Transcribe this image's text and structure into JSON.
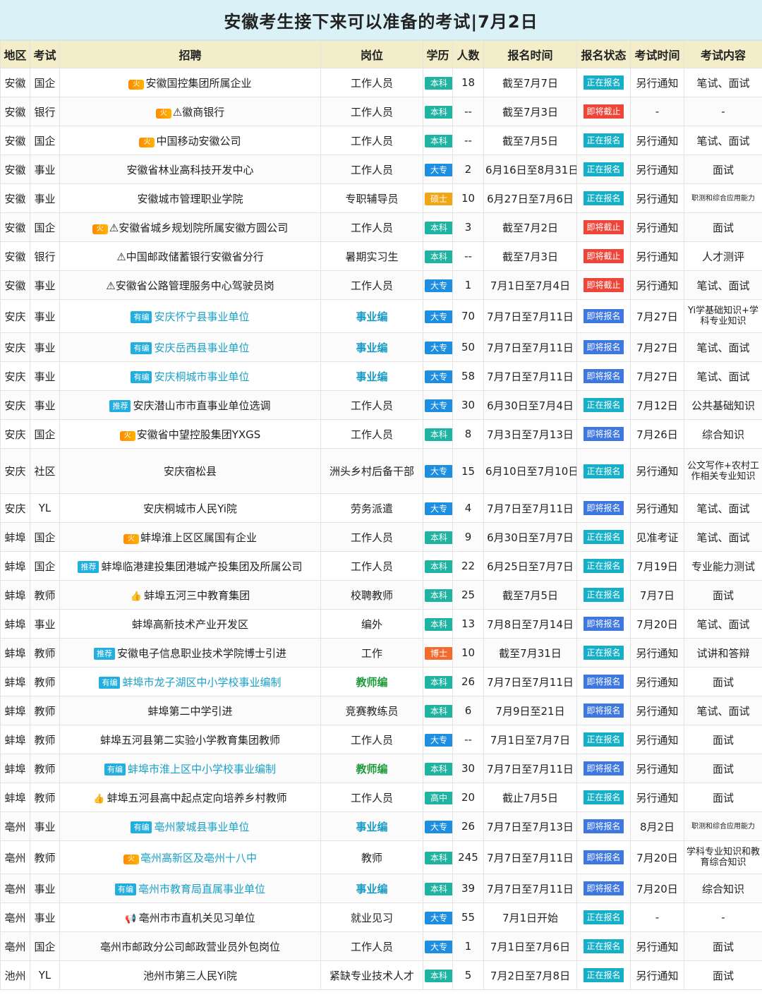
{
  "title": "安徽考生接下来可以准备的考试|7月2日",
  "headers": [
    "地区",
    "考试",
    "招聘",
    "岗位",
    "学历",
    "人数",
    "报名时间",
    "报名状态",
    "考试时间",
    "考试内容"
  ],
  "colors": {
    "header_bg": "#f4edc9",
    "title_bg": "#d9f1f7",
    "edu_benke": "#1fb3a2",
    "edu_dazhuan": "#1e8fe0",
    "edu_shuoshi": "#f3a516",
    "edu_boshi": "#f26a2e",
    "edu_gaozhong": "#1fb3a2",
    "status_open": "#15b0c8",
    "status_closing": "#ee4538",
    "status_soon": "#3e77e0"
  },
  "rows": [
    {
      "region": "安徽",
      "type": "国企",
      "tag": "fire",
      "tag_label": "火",
      "recruit": "安徽国控集团所属企业",
      "rstyle": "",
      "post": "工作人员",
      "pstyle": "",
      "edu": "本科",
      "count": "18",
      "time": "截至7月7日",
      "status": "正在报名",
      "exam": "另行通知",
      "content": "笔试、面试",
      "cstyle": ""
    },
    {
      "region": "安徽",
      "type": "银行",
      "tag": "fire",
      "tag_label": "火",
      "recruit": "⚠徽商银行",
      "rstyle": "",
      "post": "工作人员",
      "pstyle": "",
      "edu": "本科",
      "count": "--",
      "time": "截至7月3日",
      "status": "即将截止",
      "exam": "-",
      "content": "-",
      "cstyle": ""
    },
    {
      "region": "安徽",
      "type": "国企",
      "tag": "fire",
      "tag_label": "火",
      "recruit": "中国移动安徽公司",
      "rstyle": "",
      "post": "工作人员",
      "pstyle": "",
      "edu": "本科",
      "count": "--",
      "time": "截至7月5日",
      "status": "正在报名",
      "exam": "另行通知",
      "content": "笔试、面试",
      "cstyle": ""
    },
    {
      "region": "安徽",
      "type": "事业",
      "tag": "",
      "tag_label": "",
      "recruit": "安徽省林业高科技开发中心",
      "rstyle": "",
      "post": "工作人员",
      "pstyle": "",
      "edu": "大专",
      "count": "2",
      "time": "6月16日至8月31日",
      "status": "正在报名",
      "exam": "另行通知",
      "content": "面试",
      "cstyle": ""
    },
    {
      "region": "安徽",
      "type": "事业",
      "tag": "",
      "tag_label": "",
      "recruit": "安徽城市管理职业学院",
      "rstyle": "",
      "post": "专职辅导员",
      "pstyle": "",
      "edu": "硕士",
      "count": "10",
      "time": "6月27日至7月6日",
      "status": "正在报名",
      "exam": "另行通知",
      "content": "职测和综合应用能力",
      "cstyle": "small"
    },
    {
      "region": "安徽",
      "type": "国企",
      "tag": "fire",
      "tag_label": "火",
      "recruit": "⚠安徽省城乡规划院所属安徽方圆公司",
      "rstyle": "",
      "post": "工作人员",
      "pstyle": "",
      "edu": "本科",
      "count": "3",
      "time": "截至7月2日",
      "status": "即将截止",
      "exam": "另行通知",
      "content": "面试",
      "cstyle": ""
    },
    {
      "region": "安徽",
      "type": "银行",
      "tag": "",
      "tag_label": "",
      "recruit": "⚠中国邮政储蓄银行安徽省分行",
      "rstyle": "",
      "post": "暑期实习生",
      "pstyle": "",
      "edu": "本科",
      "count": "--",
      "time": "截至7月3日",
      "status": "即将截止",
      "exam": "另行通知",
      "content": "人才测评",
      "cstyle": ""
    },
    {
      "region": "安徽",
      "type": "事业",
      "tag": "",
      "tag_label": "",
      "recruit": "⚠安徽省公路管理服务中心驾驶员岗",
      "rstyle": "",
      "post": "工作人员",
      "pstyle": "",
      "edu": "大专",
      "count": "1",
      "time": "7月1日至7月4日",
      "status": "即将截止",
      "exam": "另行通知",
      "content": "笔试、面试",
      "cstyle": ""
    },
    {
      "region": "安庆",
      "type": "事业",
      "tag": "you",
      "tag_label": "有编",
      "recruit": "安庆怀宁县事业单位",
      "rstyle": "teal",
      "post": "事业编",
      "pstyle": "teal-bold",
      "edu": "大专",
      "count": "70",
      "time": "7月7日至7月11日",
      "status": "即将报名",
      "exam": "7月27日",
      "content": "Yi学基础知识+学科专业知识",
      "cstyle": "wrap",
      "tall": "tall"
    },
    {
      "region": "安庆",
      "type": "事业",
      "tag": "you",
      "tag_label": "有编",
      "recruit": "安庆岳西县事业单位",
      "rstyle": "teal",
      "post": "事业编",
      "pstyle": "teal-bold",
      "edu": "大专",
      "count": "50",
      "time": "7月7日至7月11日",
      "status": "即将报名",
      "exam": "7月27日",
      "content": "笔试、面试",
      "cstyle": ""
    },
    {
      "region": "安庆",
      "type": "事业",
      "tag": "you",
      "tag_label": "有编",
      "recruit": "安庆桐城市事业单位",
      "rstyle": "teal",
      "post": "事业编",
      "pstyle": "teal-bold",
      "edu": "大专",
      "count": "58",
      "time": "7月7日至7月11日",
      "status": "即将报名",
      "exam": "7月27日",
      "content": "笔试、面试",
      "cstyle": ""
    },
    {
      "region": "安庆",
      "type": "事业",
      "tag": "tui",
      "tag_label": "推荐",
      "recruit": "安庆潜山市市直事业单位选调",
      "rstyle": "",
      "post": "工作人员",
      "pstyle": "",
      "edu": "大专",
      "count": "30",
      "time": "6月30日至7月4日",
      "status": "正在报名",
      "exam": "7月12日",
      "content": "公共基础知识",
      "cstyle": ""
    },
    {
      "region": "安庆",
      "type": "国企",
      "tag": "fire",
      "tag_label": "火",
      "recruit": "安徽省中望控股集团YXGS",
      "rstyle": "",
      "post": "工作人员",
      "pstyle": "",
      "edu": "本科",
      "count": "8",
      "time": "7月3日至7月13日",
      "status": "即将报名",
      "exam": "7月26日",
      "content": "综合知识",
      "cstyle": ""
    },
    {
      "region": "安庆",
      "type": "社区",
      "tag": "",
      "tag_label": "",
      "recruit": "安庆宿松县",
      "rstyle": "",
      "post": "洲头乡村后备干部",
      "pstyle": "",
      "edu": "大专",
      "count": "15",
      "time": "6月10日至7月10日",
      "status": "正在报名",
      "exam": "另行通知",
      "content": "公文写作+农村工作相关专业知识",
      "cstyle": "wrap",
      "tall": "xtall"
    },
    {
      "region": "安庆",
      "type": "YL",
      "tag": "",
      "tag_label": "",
      "recruit": "安庆桐城市人民Yi院",
      "rstyle": "",
      "post": "劳务派遣",
      "pstyle": "",
      "edu": "大专",
      "count": "4",
      "time": "7月7日至7月11日",
      "status": "即将报名",
      "exam": "另行通知",
      "content": "笔试、面试",
      "cstyle": ""
    },
    {
      "region": "蚌埠",
      "type": "国企",
      "tag": "fire",
      "tag_label": "火",
      "recruit": "蚌埠淮上区区属国有企业",
      "rstyle": "",
      "post": "工作人员",
      "pstyle": "",
      "edu": "本科",
      "count": "9",
      "time": "6月30日至7月7日",
      "status": "正在报名",
      "exam": "见准考证",
      "content": "笔试、面试",
      "cstyle": ""
    },
    {
      "region": "蚌埠",
      "type": "国企",
      "tag": "tui",
      "tag_label": "推荐",
      "recruit": "蚌埠临港建投集团港城产投集团及所属公司",
      "rstyle": "",
      "post": "工作人员",
      "pstyle": "",
      "edu": "本科",
      "count": "22",
      "time": "6月25日至7月7日",
      "status": "正在报名",
      "exam": "7月19日",
      "content": "专业能力测试",
      "cstyle": ""
    },
    {
      "region": "蚌埠",
      "type": "教师",
      "tag": "thumb",
      "tag_label": "👍",
      "recruit": "蚌埠五河三中教育集团",
      "rstyle": "",
      "post": "校聘教师",
      "pstyle": "",
      "edu": "本科",
      "count": "25",
      "time": "截至7月5日",
      "status": "正在报名",
      "exam": "7月7日",
      "content": "面试",
      "cstyle": ""
    },
    {
      "region": "蚌埠",
      "type": "事业",
      "tag": "",
      "tag_label": "",
      "recruit": "蚌埠高新技术产业开发区",
      "rstyle": "",
      "post": "编外",
      "pstyle": "",
      "edu": "本科",
      "count": "13",
      "time": "7月8日至7月14日",
      "status": "即将报名",
      "exam": "7月20日",
      "content": "笔试、面试",
      "cstyle": ""
    },
    {
      "region": "蚌埠",
      "type": "教师",
      "tag": "tui",
      "tag_label": "推荐",
      "recruit": "安徽电子信息职业技术学院博士引进",
      "rstyle": "",
      "post": "工作",
      "pstyle": "",
      "edu": "博士",
      "count": "10",
      "time": "截至7月31日",
      "status": "正在报名",
      "exam": "另行通知",
      "content": "试讲和答辩",
      "cstyle": ""
    },
    {
      "region": "蚌埠",
      "type": "教师",
      "tag": "you",
      "tag_label": "有编",
      "recruit": "蚌埠市龙子湖区中小学校事业编制",
      "rstyle": "teal",
      "post": "教师编",
      "pstyle": "green-bold",
      "edu": "本科",
      "count": "26",
      "time": "7月7日至7月11日",
      "status": "即将报名",
      "exam": "另行通知",
      "content": "面试",
      "cstyle": ""
    },
    {
      "region": "蚌埠",
      "type": "教师",
      "tag": "",
      "tag_label": "",
      "recruit": "蚌埠第二中学引进",
      "rstyle": "",
      "post": "竞赛教练员",
      "pstyle": "",
      "edu": "本科",
      "count": "6",
      "time": "7月9日至21日",
      "status": "即将报名",
      "exam": "另行通知",
      "content": "笔试、面试",
      "cstyle": ""
    },
    {
      "region": "蚌埠",
      "type": "教师",
      "tag": "",
      "tag_label": "",
      "recruit": "蚌埠五河县第二实验小学教育集团教师",
      "rstyle": "",
      "post": "工作人员",
      "pstyle": "",
      "edu": "大专",
      "count": "--",
      "time": "7月1日至7月7日",
      "status": "正在报名",
      "exam": "另行通知",
      "content": "面试",
      "cstyle": ""
    },
    {
      "region": "蚌埠",
      "type": "教师",
      "tag": "you",
      "tag_label": "有编",
      "recruit": "蚌埠市淮上区中小学校事业编制",
      "rstyle": "teal",
      "post": "教师编",
      "pstyle": "green-bold",
      "edu": "本科",
      "count": "30",
      "time": "7月7日至7月11日",
      "status": "即将报名",
      "exam": "另行通知",
      "content": "面试",
      "cstyle": ""
    },
    {
      "region": "蚌埠",
      "type": "教师",
      "tag": "thumb",
      "tag_label": "👍",
      "recruit": "蚌埠五河县高中起点定向培养乡村教师",
      "rstyle": "",
      "post": "工作人员",
      "pstyle": "",
      "edu": "高中",
      "count": "20",
      "time": "截止7月5日",
      "status": "正在报名",
      "exam": "另行通知",
      "content": "面试",
      "cstyle": ""
    },
    {
      "region": "亳州",
      "type": "事业",
      "tag": "you",
      "tag_label": "有编",
      "recruit": "亳州蒙城县事业单位",
      "rstyle": "teal",
      "post": "事业编",
      "pstyle": "teal-bold",
      "edu": "大专",
      "count": "26",
      "time": "7月7日至7月13日",
      "status": "即将报名",
      "exam": "8月2日",
      "content": "职测和综合应用能力",
      "cstyle": "small"
    },
    {
      "region": "亳州",
      "type": "教师",
      "tag": "fire",
      "tag_label": "火",
      "recruit": "亳州高新区及亳州十八中",
      "rstyle": "teal",
      "post": "教师",
      "pstyle": "",
      "edu": "本科",
      "count": "245",
      "time": "7月7日至7月11日",
      "status": "即将报名",
      "exam": "7月20日",
      "content": "学科专业知识和教育综合知识",
      "cstyle": "wrap",
      "tall": "tall"
    },
    {
      "region": "亳州",
      "type": "事业",
      "tag": "you",
      "tag_label": "有编",
      "recruit": "亳州市教育局直属事业单位",
      "rstyle": "teal",
      "post": "事业编",
      "pstyle": "teal-bold",
      "edu": "本科",
      "count": "39",
      "time": "7月7日至7月11日",
      "status": "即将报名",
      "exam": "7月20日",
      "content": "综合知识",
      "cstyle": ""
    },
    {
      "region": "亳州",
      "type": "事业",
      "tag": "speaker",
      "tag_label": "📢",
      "recruit": "亳州市市直机关见习单位",
      "rstyle": "",
      "post": "就业见习",
      "pstyle": "",
      "edu": "大专",
      "count": "55",
      "time": "7月1日开始",
      "status": "正在报名",
      "exam": "-",
      "content": "-",
      "cstyle": ""
    },
    {
      "region": "亳州",
      "type": "国企",
      "tag": "",
      "tag_label": "",
      "recruit": "亳州市邮政分公司邮政营业员外包岗位",
      "rstyle": "",
      "post": "工作人员",
      "pstyle": "",
      "edu": "大专",
      "count": "1",
      "time": "7月1日至7月6日",
      "status": "正在报名",
      "exam": "另行通知",
      "content": "面试",
      "cstyle": ""
    },
    {
      "region": "池州",
      "type": "YL",
      "tag": "",
      "tag_label": "",
      "recruit": "池州市第三人民Yi院",
      "rstyle": "",
      "post": "紧缺专业技术人才",
      "pstyle": "",
      "edu": "本科",
      "count": "5",
      "time": "7月2日至7月8日",
      "status": "正在报名",
      "exam": "另行通知",
      "content": "面试",
      "cstyle": ""
    }
  ]
}
